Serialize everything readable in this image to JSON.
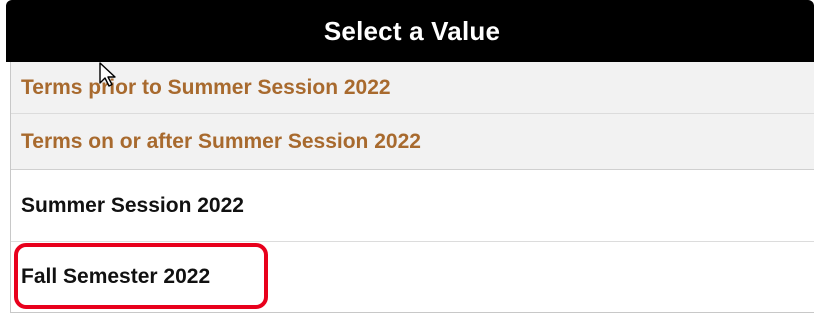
{
  "dialog": {
    "title": "Select a Value",
    "header_color": "#000000"
  },
  "options": [
    {
      "label": "Terms prior to Summer Session 2022",
      "style": "group-header"
    },
    {
      "label": "Terms on or after Summer Session 2022",
      "style": "group-header"
    },
    {
      "label": "Summer Session 2022",
      "style": "value"
    },
    {
      "label": "Fall Semester 2022",
      "style": "value",
      "highlighted": true
    }
  ],
  "colors": {
    "group_text": "#a86a2e",
    "value_text": "#111111",
    "highlight_outline": "#e8001c"
  },
  "icons": {
    "cursor": "mouse-pointer-icon"
  }
}
